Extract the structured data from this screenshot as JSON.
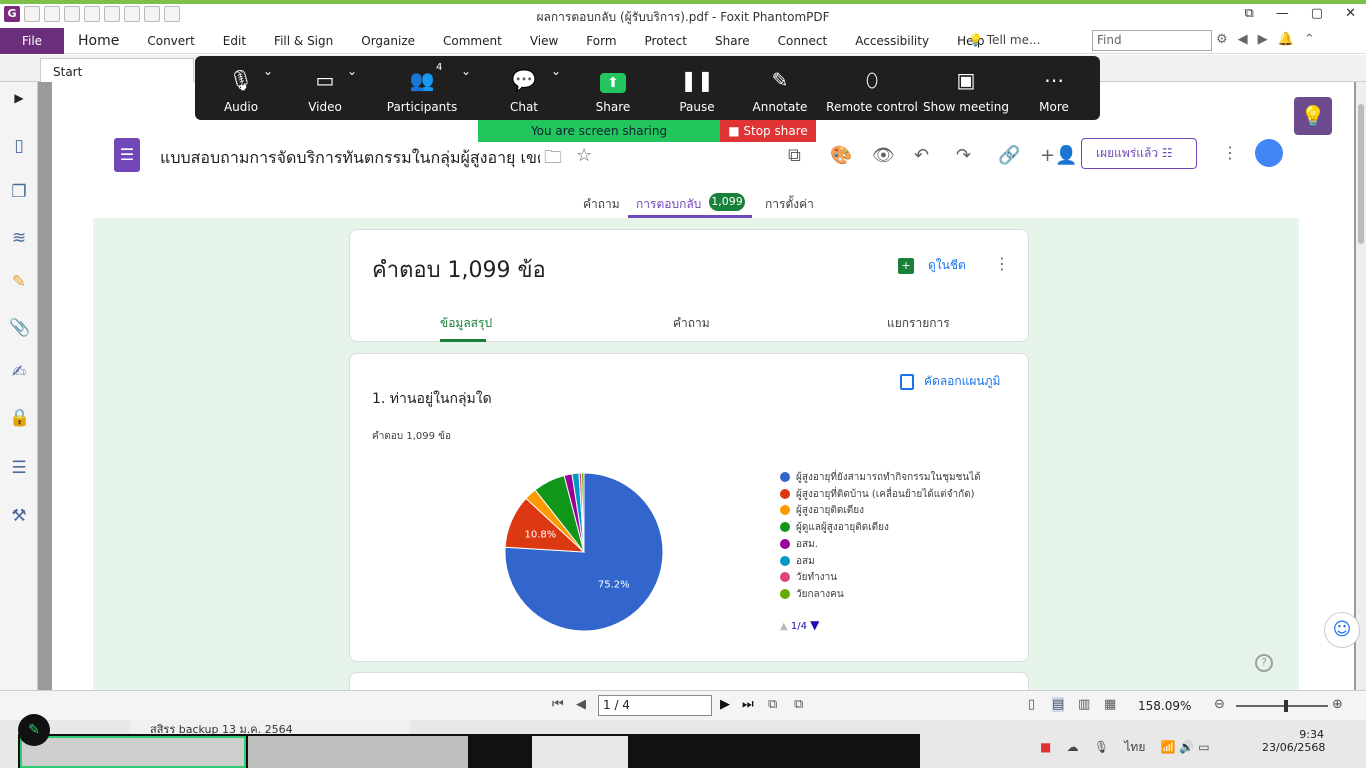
{
  "window": {
    "title": "ผลการตอบกลับ (ผู้รับบริการ).pdf - Foxit PhantomPDF",
    "buttons": [
      "⧉",
      "—",
      "▢",
      "✕"
    ]
  },
  "ribbon": {
    "file": "File",
    "items": [
      "Home",
      "Convert",
      "Edit",
      "Fill & Sign",
      "Organize",
      "Comment",
      "View",
      "Form",
      "Protect",
      "Share",
      "Connect",
      "Accessibility",
      "Help"
    ],
    "tell_me": "Tell me...",
    "find_placeholder": "Find"
  },
  "tab": {
    "start": "Start"
  },
  "zoom_toolbar": {
    "audio": "Audio",
    "video": "Video",
    "participants": "Participants",
    "participants_count": "4",
    "chat": "Chat",
    "share": "Share",
    "pause": "Pause",
    "annotate": "Annotate",
    "remote_control": "Remote control",
    "show_meeting": "Show meeting",
    "more": "More",
    "sharing_banner": "You are screen sharing",
    "stop_share": "Stop share"
  },
  "form": {
    "title": "แบบสอบถามการจัดบริการทันตกรรมในกลุ่มผู้สูงอายุ เขตสุขภา",
    "publish_button": "เผยแพร่แล้ว",
    "tabs": {
      "questions": "คำถาม",
      "responses": "การตอบกลับ",
      "responses_count": "1,099",
      "settings": "การตั้งค่า"
    },
    "responses_card": {
      "heading": "คำตอบ 1,099 ข้อ",
      "sheets_link": "ดูในชีต",
      "subtabs": {
        "summary": "ข้อมูลสรุป",
        "question": "คำถาม",
        "individual": "แยกรายการ"
      }
    },
    "question_card": {
      "question": "1. ท่านอยู่ในกลุ่มใด",
      "response_count": "คำตอบ 1,099 ข้อ",
      "copy_chart": "คัดลอกแผนภูมิ",
      "pager": "1/4"
    }
  },
  "chart_data": {
    "type": "pie",
    "labels": [
      "ผู้สูงอายุที่ยังสามารถทำกิจกรรมในชุมชนได้",
      "ผู้สูงอายุที่ติดบ้าน (เคลื่อนย้ายได้แต่จำกัด)",
      "ผู้สูงอายุติดเตียง",
      "ผู้ดูแลผู้สูงอายุติดเตียง",
      "อสม.",
      "อสม",
      "วัยทำงาน",
      "วัยกลางคน"
    ],
    "values": [
      75.2,
      10.8,
      2.5,
      6.5,
      1.6,
      1.4,
      0.5,
      0.5
    ],
    "data_labels": [
      "75.2%",
      "10.8%",
      "",
      "",
      "",
      "",
      "",
      ""
    ],
    "colors": [
      "#3366cc",
      "#dc3912",
      "#ff9900",
      "#109618",
      "#990099",
      "#0099c6",
      "#dd4477",
      "#66aa00"
    ],
    "legend_position": "right"
  },
  "status_bar": {
    "page": "1 / 4",
    "zoom": "158.09%"
  },
  "taskbar": {
    "explorer_item": "สสิรร backup 13 ม.ค. 2564",
    "time": "9:34",
    "date": "23/06/2568",
    "lang": "ไทย"
  }
}
